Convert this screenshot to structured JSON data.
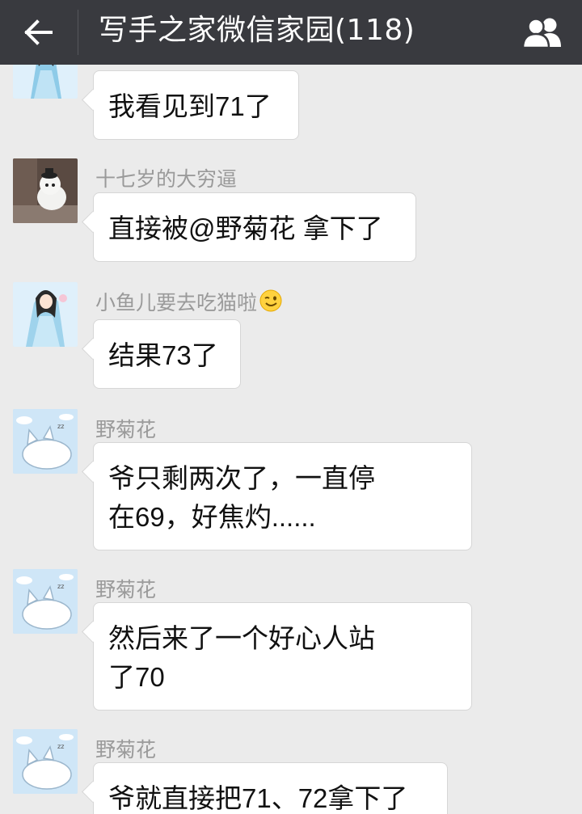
{
  "header": {
    "title": "写手之家微信家园(118)",
    "back_icon": "arrow-left-icon",
    "members_icon": "group-members-icon"
  },
  "messages": [
    {
      "sender": "",
      "avatar": "anime-girl-avatar",
      "text": "我看见到71了"
    },
    {
      "sender": "十七岁的大穷逼",
      "avatar": "white-dog-avatar",
      "text": "直接被@野菊花 拿下了"
    },
    {
      "sender": "小鱼儿要去吃猫啦",
      "sender_emoji": "wink-emoji-icon",
      "avatar": "anime-girl-avatar",
      "text": "结果73了"
    },
    {
      "sender": "野菊花",
      "avatar": "sleeping-cat-avatar",
      "text": "爷只剩两次了，一直停\n在69，好焦灼......"
    },
    {
      "sender": "野菊花",
      "avatar": "sleeping-cat-avatar",
      "text": "然后来了一个好心人站\n了70"
    },
    {
      "sender": "野菊花",
      "avatar": "sleeping-cat-avatar",
      "text": "爷就直接把71、72拿下了"
    }
  ],
  "colors": {
    "header_bg": "#393a3f",
    "chat_bg": "#ebebeb",
    "bubble_bg": "#ffffff",
    "sender_text": "#9a9a9a"
  }
}
